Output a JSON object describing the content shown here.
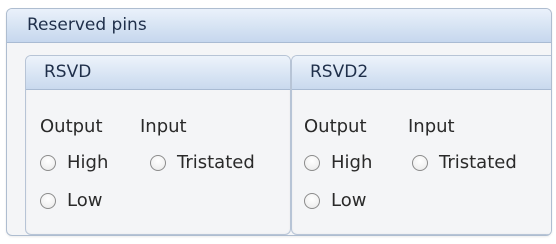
{
  "panel": {
    "title": "Reserved pins",
    "groups": [
      {
        "title": "RSVD",
        "output_label": "Output",
        "input_label": "Input",
        "radios": {
          "high": "High",
          "low": "Low",
          "tristated": "Tristated"
        }
      },
      {
        "title": "RSVD2",
        "output_label": "Output",
        "input_label": "Input",
        "radios": {
          "high": "High",
          "low": "Low",
          "tristated": "Tristated"
        }
      }
    ]
  }
}
